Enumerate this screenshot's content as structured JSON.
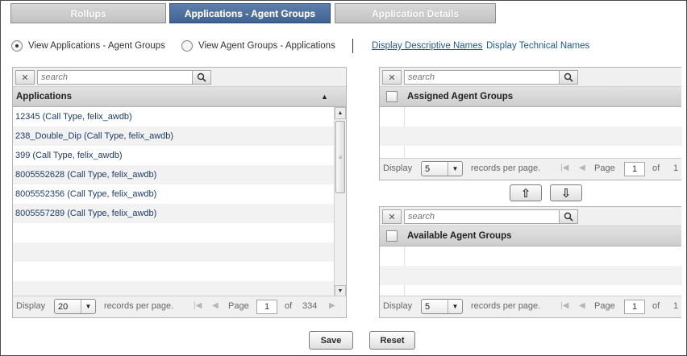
{
  "tabs": [
    {
      "label": "Rollups",
      "active": false
    },
    {
      "label": "Applications - Agent Groups",
      "active": true
    },
    {
      "label": "Application Details",
      "active": false
    }
  ],
  "view_options": {
    "option1": "View Applications - Agent Groups",
    "option2": "View Agent Groups - Applications",
    "selected": "option1"
  },
  "name_links": {
    "descriptive": "Display Descriptive Names",
    "technical": "Display Technical Names"
  },
  "applications_panel": {
    "search_placeholder": "search",
    "column_header": "Applications",
    "sort_indicator": "▲",
    "rows": [
      "12345 (Call Type,  felix_awdb)",
      "238_Double_Dip (Call Type,  felix_awdb)",
      "399 (Call Type,  felix_awdb)",
      "8005552628 (Call Type,  felix_awdb)",
      "8005552356 (Call Type,  felix_awdb)",
      "8005557289 (Call Type,  felix_awdb)"
    ],
    "footer": {
      "display_label": "Display",
      "per_page_value": "20",
      "records_label": "records per page.",
      "page_label": "Page",
      "page_value": "1",
      "of_label": "of",
      "total_pages": "334"
    }
  },
  "assigned_panel": {
    "search_placeholder": "search",
    "column_header": "Assigned Agent Groups",
    "footer": {
      "display_label": "Display",
      "per_page_value": "5",
      "records_label": "records per page.",
      "page_label": "Page",
      "page_value": "1",
      "of_label": "of",
      "total_pages": "1"
    }
  },
  "transfer": {
    "up_icon": "⇧",
    "down_icon": "⇩"
  },
  "available_panel": {
    "search_placeholder": "search",
    "column_header": "Available Agent Groups",
    "footer": {
      "display_label": "Display",
      "per_page_value": "5",
      "records_label": "records per page.",
      "page_label": "Page",
      "page_value": "1",
      "of_label": "of",
      "total_pages": "1"
    }
  },
  "actions": {
    "save": "Save",
    "reset": "Reset"
  }
}
